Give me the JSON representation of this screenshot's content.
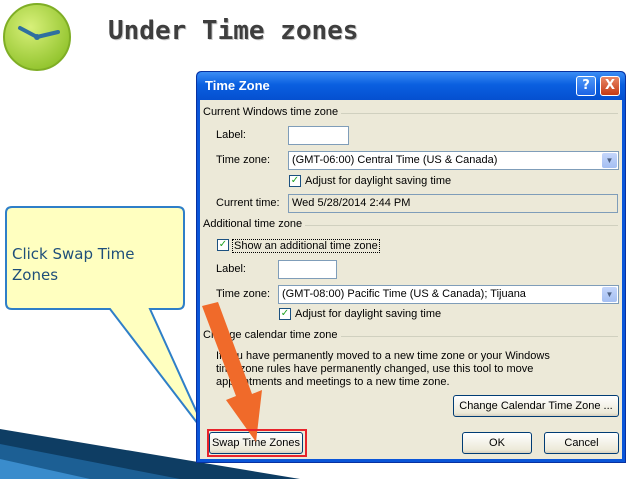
{
  "slide": {
    "title": "Under Time zones",
    "callout_text": "Click Swap Time Zones"
  },
  "dialog": {
    "title": "Time Zone",
    "help_label": "?",
    "close_label": "X",
    "current": {
      "group_label": "Current Windows time zone",
      "label_caption": "Label:",
      "label_value": "",
      "timezone_caption": "Time zone:",
      "timezone_value": "(GMT-06:00) Central Time (US & Canada)",
      "dst_label": "Adjust for daylight saving time",
      "dst_checked": true,
      "current_time_caption": "Current time:",
      "current_time_value": "Wed 5/28/2014 2:44 PM"
    },
    "additional": {
      "group_label": "Additional time zone",
      "show_label": "Show an additional time zone",
      "show_checked": true,
      "label_caption": "Label:",
      "label_value": "",
      "timezone_caption": "Time zone:",
      "timezone_value": "(GMT-08:00) Pacific Time (US & Canada); Tijuana",
      "dst_label": "Adjust for daylight saving time",
      "dst_checked": true
    },
    "calendar": {
      "group_label": "Change calendar time zone",
      "line1": "If you have permanently moved to a new time zone or your Windows",
      "line2": "time zone rules have permanently changed, use this tool to move",
      "line3": "appointments and meetings to a new time zone.",
      "change_button": "Change Calendar Time Zone ..."
    },
    "buttons": {
      "swap": "Swap Time Zones",
      "ok": "OK",
      "cancel": "Cancel"
    }
  },
  "colors": {
    "titlebar": "#0a5fe0",
    "dialog_face": "#ece9d8",
    "highlight": "#e8232b",
    "arrow": "#f06a2a",
    "callout_fill": "#ffffc0",
    "callout_border": "#2f7fc8"
  }
}
